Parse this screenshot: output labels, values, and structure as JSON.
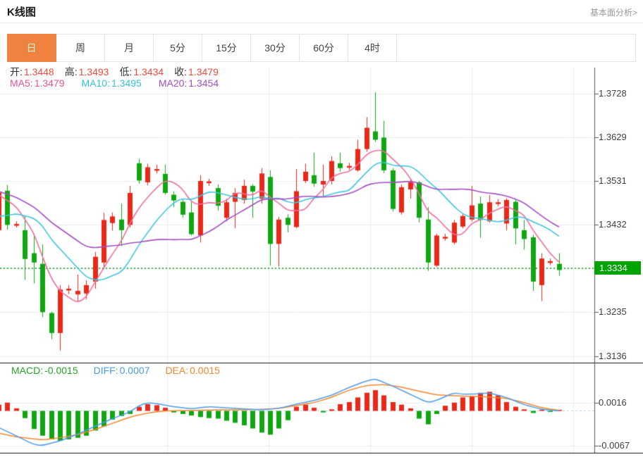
{
  "header": {
    "title": "K线图",
    "link": "基本面分析>"
  },
  "tabs": [
    {
      "label": "日",
      "active": true
    },
    {
      "label": "周",
      "active": false
    },
    {
      "label": "月",
      "active": false
    },
    {
      "label": "5分",
      "active": false
    },
    {
      "label": "15分",
      "active": false
    },
    {
      "label": "30分",
      "active": false
    },
    {
      "label": "60分",
      "active": false
    },
    {
      "label": "4时",
      "active": false
    }
  ],
  "legend_ohlc": [
    {
      "label": "开:",
      "value": "1.3448"
    },
    {
      "label": "高:",
      "value": "1.3493"
    },
    {
      "label": "低:",
      "value": "1.3434"
    },
    {
      "label": "收:",
      "value": "1.3479"
    }
  ],
  "legend_ma": [
    {
      "label": "MA5:",
      "value": "1.3479",
      "color": "#f0508e"
    },
    {
      "label": "MA10:",
      "value": "1.3495",
      "color": "#35c3da"
    },
    {
      "label": "MA20:",
      "value": "1.3454",
      "color": "#a44fc0"
    }
  ],
  "legend_macd": [
    {
      "label": "MACD:",
      "value": "-0.0015",
      "color": "#28a428"
    },
    {
      "label": "DIFF:",
      "value": "0.0007",
      "color": "#4a9ce8"
    },
    {
      "label": "DEA:",
      "value": "0.0015",
      "color": "#f5862c"
    }
  ],
  "colors": {
    "up": "#e92817",
    "down": "#0fa611",
    "tab_active_bg": "#f0823f",
    "tab_active_text": "#fdf6d8",
    "badge_bg": "#00a400",
    "last_price_line": "#3fae46",
    "ma5": "#f06e9e",
    "ma10": "#3ec6dc",
    "ma20": "#a44fc0",
    "diff_line": "#4a9ce8",
    "dea_line": "#f5862c",
    "grid": "#e9eef6",
    "axis": "#555",
    "panel_border": "#151515",
    "zero_dash": "#b9d2ec"
  },
  "chart_data": {
    "type": "candlestick_with_macd",
    "main": {
      "title": "K线图 日线",
      "y_ticks": [
        "1.3728",
        "1.3629",
        "1.3531",
        "1.3432",
        "1.3334",
        "1.3235",
        "1.3136"
      ],
      "last_price": "1.3334",
      "ma_periods": [
        5,
        10,
        20
      ],
      "ma_seed": [
        1.357,
        1.3568,
        1.3565,
        1.3562,
        1.3565,
        1.356,
        1.3563,
        1.3566,
        1.3562,
        1.3565,
        1.3408,
        1.3395,
        1.3402,
        1.3398,
        1.3405,
        1.35,
        1.3498,
        1.3502,
        1.3496
      ],
      "candles": [
        [
          1.342,
          1.3512,
          1.3412,
          1.3505
        ],
        [
          1.3509,
          1.3522,
          1.3421,
          1.3432
        ],
        [
          1.343,
          1.344,
          1.3426,
          1.3434
        ],
        [
          1.342,
          1.3452,
          1.3308,
          1.3355
        ],
        [
          1.3368,
          1.3412,
          1.33,
          1.3347
        ],
        [
          1.3344,
          1.3388,
          1.3224,
          1.3235
        ],
        [
          1.3233,
          1.3236,
          1.3174,
          1.3188
        ],
        [
          1.3188,
          1.3296,
          1.3148,
          1.3286
        ],
        [
          1.3284,
          1.3296,
          1.3276,
          1.3288
        ],
        [
          1.3275,
          1.332,
          1.326,
          1.3283
        ],
        [
          1.3277,
          1.3307,
          1.3264,
          1.3296
        ],
        [
          1.3304,
          1.3371,
          1.3288,
          1.336
        ],
        [
          1.3347,
          1.3459,
          1.3332,
          1.3443
        ],
        [
          1.3436,
          1.346,
          1.3419,
          1.3451
        ],
        [
          1.3444,
          1.348,
          1.3384,
          1.342
        ],
        [
          1.3432,
          1.352,
          1.3426,
          1.3504
        ],
        [
          1.3571,
          1.3581,
          1.3525,
          1.3532
        ],
        [
          1.3528,
          1.357,
          1.3521,
          1.3562
        ],
        [
          1.3554,
          1.3568,
          1.3548,
          1.3558
        ],
        [
          1.3547,
          1.3568,
          1.35,
          1.3504
        ],
        [
          1.35,
          1.3508,
          1.3472,
          1.3487
        ],
        [
          1.3484,
          1.3491,
          1.3448,
          1.3455
        ],
        [
          1.346,
          1.3484,
          1.3408,
          1.3411
        ],
        [
          1.3408,
          1.3544,
          1.3392,
          1.3531
        ],
        [
          1.3526,
          1.3536,
          1.352,
          1.353
        ],
        [
          1.3515,
          1.3523,
          1.3464,
          1.3475
        ],
        [
          1.3448,
          1.3491,
          1.344,
          1.3483
        ],
        [
          1.3484,
          1.3515,
          1.3424,
          1.3504
        ],
        [
          1.3488,
          1.3534,
          1.348,
          1.352
        ],
        [
          1.352,
          1.3524,
          1.3448,
          1.3507
        ],
        [
          1.3491,
          1.356,
          1.348,
          1.3548
        ],
        [
          1.354,
          1.3555,
          1.334,
          1.3389
        ],
        [
          1.3389,
          1.345,
          1.3338,
          1.3444
        ],
        [
          1.3448,
          1.3456,
          1.3415,
          1.3432
        ],
        [
          1.3427,
          1.3558,
          1.3424,
          1.3508
        ],
        [
          1.3531,
          1.357,
          1.3526,
          1.3552
        ],
        [
          1.3544,
          1.3595,
          1.3518,
          1.3525
        ],
        [
          1.3523,
          1.3568,
          1.3496,
          1.3531
        ],
        [
          1.3531,
          1.3587,
          1.3523,
          1.3576
        ],
        [
          1.3571,
          1.3595,
          1.3552,
          1.356
        ],
        [
          1.3561,
          1.3572,
          1.3556,
          1.3565
        ],
        [
          1.3555,
          1.3624,
          1.3552,
          1.3603
        ],
        [
          1.3603,
          1.3675,
          1.3597,
          1.3651
        ],
        [
          1.3643,
          1.3731,
          1.3619,
          1.3624
        ],
        [
          1.3629,
          1.3667,
          1.3549,
          1.3555
        ],
        [
          1.3555,
          1.356,
          1.3462,
          1.3468
        ],
        [
          1.346,
          1.3523,
          1.3455,
          1.3517
        ],
        [
          1.3512,
          1.3536,
          1.3491,
          1.3528
        ],
        [
          1.3528,
          1.3531,
          1.3437,
          1.3448
        ],
        [
          1.3444,
          1.3472,
          1.3328,
          1.3347
        ],
        [
          1.334,
          1.3412,
          1.3337,
          1.3408
        ],
        [
          1.3401,
          1.3412,
          1.3396,
          1.3405
        ],
        [
          1.3392,
          1.3443,
          1.3388,
          1.3437
        ],
        [
          1.3428,
          1.3456,
          1.3424,
          1.3452
        ],
        [
          1.3444,
          1.352,
          1.344,
          1.3476
        ],
        [
          1.348,
          1.3496,
          1.3403,
          1.3443
        ],
        [
          1.344,
          1.3499,
          1.3437,
          1.3483
        ],
        [
          1.3479,
          1.349,
          1.3474,
          1.3483
        ],
        [
          1.3435,
          1.3492,
          1.342,
          1.3488
        ],
        [
          1.3484,
          1.3488,
          1.3388,
          1.3424
        ],
        [
          1.342,
          1.3443,
          1.3376,
          1.34
        ],
        [
          1.3404,
          1.341,
          1.3283,
          1.3304
        ],
        [
          1.3296,
          1.3368,
          1.326,
          1.3356
        ],
        [
          1.3346,
          1.3356,
          1.3341,
          1.335
        ],
        [
          1.3344,
          1.3368,
          1.3317,
          1.333
        ]
      ]
    },
    "macd": {
      "y_ticks": [
        "0.0016",
        "-0.0067"
      ],
      "hist": [
        0.0012,
        0.0016,
        0.0005,
        -0.0014,
        -0.0035,
        -0.0048,
        -0.0055,
        -0.0058,
        -0.0055,
        -0.0052,
        -0.0048,
        -0.0038,
        -0.003,
        -0.0017,
        -0.001,
        -0.0006,
        0.0008,
        0.0013,
        0.0011,
        0.0006,
        -0.0003,
        -0.0006,
        -0.0009,
        -0.0012,
        -0.0014,
        -0.0015,
        -0.0019,
        -0.0023,
        -0.0028,
        -0.0034,
        -0.0042,
        -0.0046,
        -0.0034,
        -0.0018,
        0.0008,
        0.0012,
        0.0006,
        -0.0003,
        0.0003,
        0.0013,
        0.0017,
        0.0026,
        0.0035,
        0.004,
        0.003,
        0.0017,
        0.0012,
        0.0005,
        -0.0015,
        -0.0026,
        -0.0006,
        0.001,
        0.0016,
        0.0026,
        0.0028,
        0.0035,
        0.0037,
        0.003,
        0.0017,
        0.0008,
        0.0003,
        -0.0004,
        0.0002,
        -0.0001,
        0.0001
      ],
      "diff_points": [
        [
          0,
          -0.0032
        ],
        [
          2,
          -0.0048
        ],
        [
          4,
          -0.0065
        ],
        [
          5,
          -0.0067
        ],
        [
          7,
          -0.0058
        ],
        [
          9,
          -0.0045
        ],
        [
          11,
          -0.003
        ],
        [
          13,
          -0.0015
        ],
        [
          15,
          -0.0002
        ],
        [
          16,
          0.001
        ],
        [
          17,
          0.0016
        ],
        [
          18,
          0.0014
        ],
        [
          20,
          0.0008
        ],
        [
          22,
          0.0004
        ],
        [
          24,
          0.0008
        ],
        [
          26,
          0.0006
        ],
        [
          28,
          0.0004
        ],
        [
          30,
          0.0002
        ],
        [
          32,
          0.0005
        ],
        [
          34,
          0.0013
        ],
        [
          36,
          0.002
        ],
        [
          38,
          0.003
        ],
        [
          40,
          0.0045
        ],
        [
          42,
          0.0058
        ],
        [
          43,
          0.0062
        ],
        [
          45,
          0.0048
        ],
        [
          47,
          0.0032
        ],
        [
          49,
          0.0016
        ],
        [
          50,
          0.002
        ],
        [
          52,
          0.0035
        ],
        [
          53,
          0.0032
        ],
        [
          55,
          0.0033
        ],
        [
          56,
          0.0035
        ],
        [
          58,
          0.0026
        ],
        [
          60,
          0.0012
        ],
        [
          62,
          0.0003
        ],
        [
          64,
          0.0
        ]
      ],
      "dea_points": [
        [
          0,
          -0.0043
        ],
        [
          2,
          -0.005
        ],
        [
          5,
          -0.0056
        ],
        [
          7,
          -0.0052
        ],
        [
          9,
          -0.0046
        ],
        [
          11,
          -0.0036
        ],
        [
          13,
          -0.0024
        ],
        [
          15,
          -0.0012
        ],
        [
          17,
          -0.0004
        ],
        [
          19,
          0.0
        ],
        [
          22,
          0.0001
        ],
        [
          25,
          0.0002
        ],
        [
          28,
          0.0002
        ],
        [
          30,
          0.0003
        ],
        [
          32,
          0.0005
        ],
        [
          34,
          0.001
        ],
        [
          36,
          0.0016
        ],
        [
          38,
          0.0026
        ],
        [
          40,
          0.004
        ],
        [
          42,
          0.0049
        ],
        [
          44,
          0.0051
        ],
        [
          46,
          0.0046
        ],
        [
          48,
          0.0038
        ],
        [
          50,
          0.0031
        ],
        [
          52,
          0.0029
        ],
        [
          54,
          0.0028
        ],
        [
          56,
          0.0027
        ],
        [
          58,
          0.0024
        ],
        [
          60,
          0.0016
        ],
        [
          62,
          0.0006
        ],
        [
          64,
          0.0001
        ]
      ]
    }
  }
}
